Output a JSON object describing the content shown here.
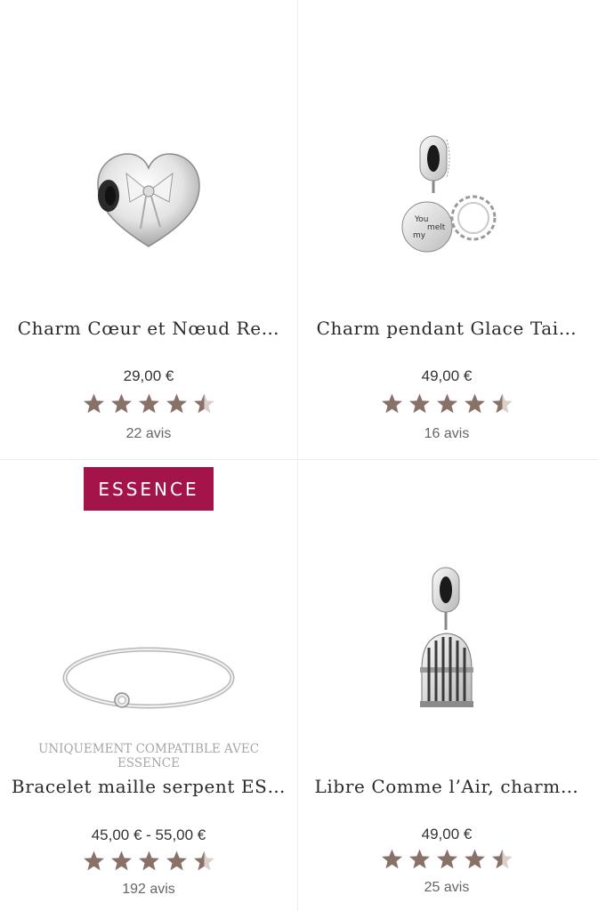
{
  "products": [
    {
      "name": "Charm Cœur et Nœud Re…",
      "price": "29,00 €",
      "rating": 4.5,
      "reviews": "22 avis",
      "image": "heart-bow-charm-icon"
    },
    {
      "name": "Charm pendant Glace Tai…",
      "price": "49,00 €",
      "rating": 4.5,
      "reviews": "16 avis",
      "image": "dangle-charm-icon",
      "engraving": [
        "You",
        "melt",
        "my"
      ]
    },
    {
      "name": "Bracelet maille serpent ES…",
      "price": "45,00 € - 55,00 €",
      "rating": 4.5,
      "reviews": "192 avis",
      "image": "bangle-bracelet-icon",
      "badge": "ESSENCE",
      "compat": [
        "UNIQUEMENT COMPATIBLE AVEC",
        "ESSENCE"
      ]
    },
    {
      "name": "Libre Comme l’Air, charm…",
      "price": "49,00 €",
      "rating": 4.5,
      "reviews": "25 avis",
      "image": "birdcage-charm-icon"
    }
  ],
  "colors": {
    "star": "#8a7168",
    "badge": "#a3154a",
    "divider": "#ececec"
  }
}
